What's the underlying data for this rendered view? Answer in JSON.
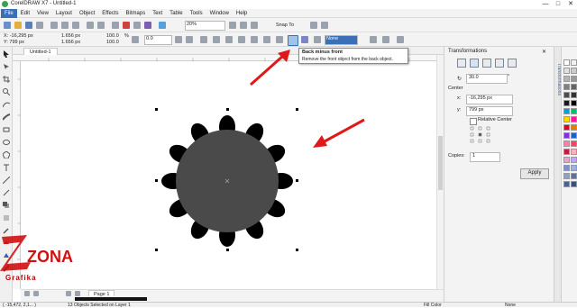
{
  "window": {
    "title": "CorelDRAW X7 - Untitled-1",
    "controls": [
      "—",
      "□",
      "✕"
    ]
  },
  "menu": [
    "File",
    "Edit",
    "View",
    "Layout",
    "Object",
    "Effects",
    "Bitmaps",
    "Text",
    "Table",
    "Tools",
    "Window",
    "Help"
  ],
  "toolbar1": {
    "zoom": "20%",
    "snap_to": "Snap To"
  },
  "toolbar2": {
    "x": "X: -16,295 px",
    "y": "Y: 799 px",
    "width": "1.656 px",
    "height": "1.656 px",
    "scale_x": "100.0",
    "scale_y": "100.0",
    "percent": "%",
    "rotation": "0.0",
    "outline": "None"
  },
  "document": {
    "tab": "Untitled-1",
    "page_tab": "Page 1"
  },
  "tooltip": {
    "title": "Back minus front",
    "description": "Remove the front object from the back object."
  },
  "transformations": {
    "title": "Transformations",
    "angle": "30.0",
    "angle_unit": "°",
    "center_label": "Center",
    "x_label": "x:",
    "x_value": "-16,295 px",
    "y_label": "y:",
    "y_value": "799 px",
    "relative_center": "Relative Center",
    "copies_label": "Copies:",
    "copies_value": "1",
    "apply": "Apply"
  },
  "sidetab": {
    "label": "Transformations"
  },
  "status": {
    "coords": "( -15,472, 2,1... )",
    "selection": "13 Objects Selected on Layer 1",
    "fill": "Fill Color",
    "outline": "None"
  },
  "watermark": {
    "brand": "ZONA",
    "sub": "Grafika"
  },
  "colors": {
    "shape_fill": "#4a4a4a",
    "petal_fill": "#000000",
    "arrow": "#e01818",
    "accent": "#3b6fb6"
  },
  "palette": [
    "#ffffff",
    "#f2f2f2",
    "#e0e0e0",
    "#cccccc",
    "#b3b3b3",
    "#999999",
    "#808080",
    "#666666",
    "#4d4d4d",
    "#333333",
    "#1a1a1a",
    "#000000",
    "#00a0e0",
    "#00c070",
    "#ffd800",
    "#ff1493",
    "#e00020",
    "#f07800",
    "#8a2be2",
    "#2060c0",
    "#ff80a0",
    "#ff4060",
    "#c02040",
    "#ffb0c0",
    "#f0a0d0",
    "#c8a0ff",
    "#8090d0",
    "#a0b0e0",
    "#90a0c0",
    "#6070a0",
    "#506090",
    "#405070"
  ]
}
